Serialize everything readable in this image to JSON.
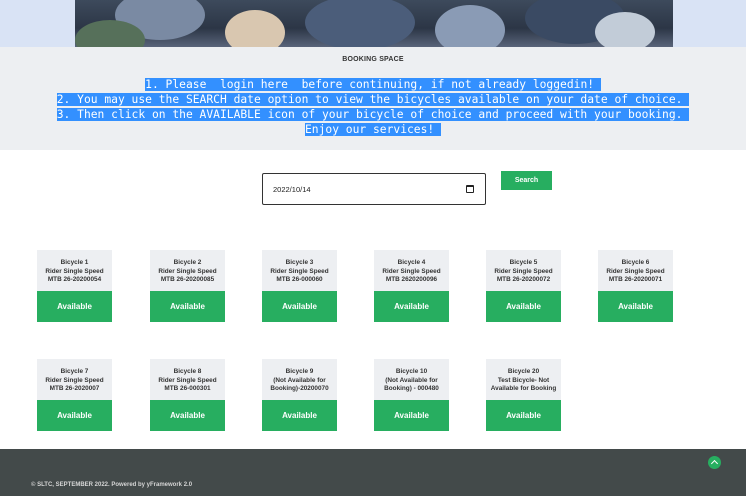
{
  "hero": {
    "image": "group-of-people-sitting-on-grass"
  },
  "info": {
    "title": "BOOKING SPACE",
    "lines": [
      "1. Please  login here  before continuing, if not already loggedin! ",
      "2. You may use the SEARCH date option to view the bicycles available on your date of choice. ",
      "3. Then click on the AVAILABLE icon of your bicycle of choice and proceed with your booking. ",
      "Enjoy our services! "
    ]
  },
  "search": {
    "date_value": "2022/10/14",
    "button_label": "Search"
  },
  "bicycles": [
    {
      "lines": [
        "Bicycle 1",
        "Rider Single Speed",
        "MTB 26-20200054"
      ],
      "status": "Available"
    },
    {
      "lines": [
        "Bicycle 2",
        "Rider Single Speed",
        "MTB 26-20200085"
      ],
      "status": "Available"
    },
    {
      "lines": [
        "Bicycle 3",
        "Rider Single Speed",
        "MTB 26-000060"
      ],
      "status": "Available"
    },
    {
      "lines": [
        "Bicycle 4",
        "Rider Single Speed",
        "MTB 2620200096"
      ],
      "status": "Available"
    },
    {
      "lines": [
        "Bicycle 5",
        "Rider Single Speed",
        "MTB 26-20200072"
      ],
      "status": "Available"
    },
    {
      "lines": [
        "Bicycle 6",
        "Rider Single Speed",
        "MTB 26-20200071"
      ],
      "status": "Available"
    },
    {
      "lines": [
        "Bicycle 7",
        "Rider Single Speed",
        "MTB 26-2020007"
      ],
      "status": "Available"
    },
    {
      "lines": [
        "Bicycle 8",
        "Rider Single Speed",
        "MTB 26-000301"
      ],
      "status": "Available"
    },
    {
      "lines": [
        "Bicycle 9",
        "(Not Available for",
        "Booking)-20200070"
      ],
      "status": "Available"
    },
    {
      "lines": [
        "Bicycle 10",
        "(Not Available for",
        "Booking) - 000480"
      ],
      "status": "Available"
    },
    {
      "lines": [
        "Bicycle 20",
        "Test Bicycle- Not",
        "Available for Booking"
      ],
      "status": "Available"
    }
  ],
  "footer": {
    "copyright": "© SLTC, SEPTEMBER 2022. Powered by yFramework 2.0",
    "scroll_icon": "scroll-to-top-icon"
  },
  "colors": {
    "accent": "#27ae60",
    "selection": "#3390ff",
    "footer_bg": "#434a4a",
    "panel_bg": "#edeff2"
  }
}
